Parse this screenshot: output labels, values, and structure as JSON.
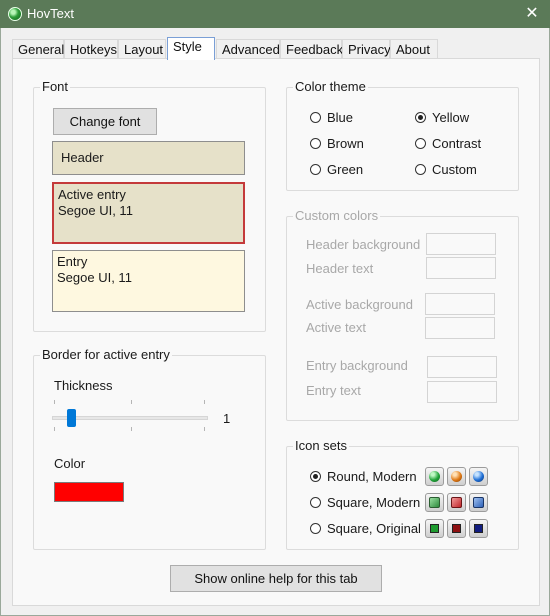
{
  "window": {
    "title": "HovText",
    "close_glyph": "✕"
  },
  "tabs": [
    {
      "label": "General"
    },
    {
      "label": "Hotkeys"
    },
    {
      "label": "Layout"
    },
    {
      "label": "Style"
    },
    {
      "label": "Advanced"
    },
    {
      "label": "Feedback"
    },
    {
      "label": "Privacy"
    },
    {
      "label": "About"
    }
  ],
  "active_tab": "Style",
  "font": {
    "title": "Font",
    "change_button": "Change font",
    "header_preview": "Header",
    "active_entry": {
      "line1": "Active entry",
      "line2": "Segoe UI, 11"
    },
    "entry": {
      "line1": "Entry",
      "line2": "Segoe UI, 11"
    },
    "colors": {
      "header_bg": "#e6e1c9",
      "active_bg": "#e6e1c9",
      "active_border": "#c43a3a",
      "entry_bg": "#fef8e0"
    }
  },
  "border": {
    "title": "Border for active entry",
    "thickness_label": "Thickness",
    "thickness_value": "1",
    "color_label": "Color",
    "color": "#ff0000"
  },
  "color_theme": {
    "title": "Color theme",
    "options": [
      {
        "label": "Blue",
        "checked": false
      },
      {
        "label": "Yellow",
        "checked": true
      },
      {
        "label": "Brown",
        "checked": false
      },
      {
        "label": "Contrast",
        "checked": false
      },
      {
        "label": "Green",
        "checked": false
      },
      {
        "label": "Custom",
        "checked": false
      }
    ]
  },
  "custom_colors": {
    "title": "Custom colors",
    "header_background": "Header background",
    "header_text": "Header text",
    "active_background": "Active background",
    "active_text": "Active text",
    "entry_background": "Entry background",
    "entry_text": "Entry text"
  },
  "icon_sets": {
    "title": "Icon sets",
    "options": [
      {
        "label": "Round, Modern",
        "checked": true,
        "icons": [
          "green-orb-icon",
          "orange-orb-icon",
          "blue-orb-icon"
        ]
      },
      {
        "label": "Square, Modern",
        "checked": false,
        "icons": [
          "green-square-icon",
          "red-square-icon",
          "blue-square-icon"
        ]
      },
      {
        "label": "Square, Original",
        "checked": false,
        "icons": [
          "green-box-icon",
          "darkred-box-icon",
          "navy-box-icon"
        ]
      }
    ]
  },
  "help_button": "Show online help for this tab"
}
